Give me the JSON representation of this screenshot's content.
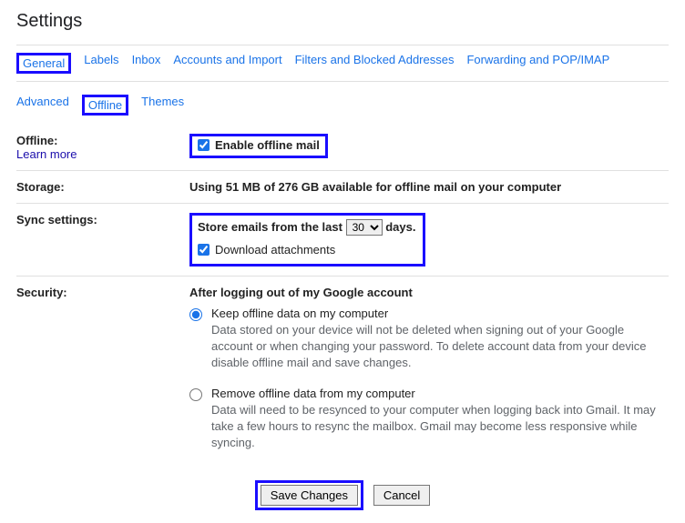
{
  "page_title": "Settings",
  "tabs_row1": [
    "General",
    "Labels",
    "Inbox",
    "Accounts and Import",
    "Filters and Blocked Addresses",
    "Forwarding and POP/IMAP"
  ],
  "tabs_row2": [
    "Advanced",
    "Offline",
    "Themes"
  ],
  "offline": {
    "label": "Offline:",
    "learn_more": "Learn more",
    "enable_label": "Enable offline mail"
  },
  "storage": {
    "label": "Storage:",
    "text": "Using 51 MB of 276 GB available for offline mail on your computer"
  },
  "sync": {
    "label": "Sync settings:",
    "store_prefix": "Store emails from the last",
    "store_suffix": "days.",
    "days_value": "30",
    "download_label": "Download attachments"
  },
  "security": {
    "label": "Security:",
    "heading": "After logging out of my Google account",
    "opt1_title": "Keep offline data on my computer",
    "opt1_desc": "Data stored on your device will not be deleted when signing out of your Google account or when changing your password. To delete account data from your device disable offline mail and save changes.",
    "opt2_title": "Remove offline data from my computer",
    "opt2_desc": "Data will need to be resynced to your computer when logging back into Gmail. It may take a few hours to resync the mailbox. Gmail may become less responsive while syncing."
  },
  "buttons": {
    "save": "Save Changes",
    "cancel": "Cancel"
  }
}
